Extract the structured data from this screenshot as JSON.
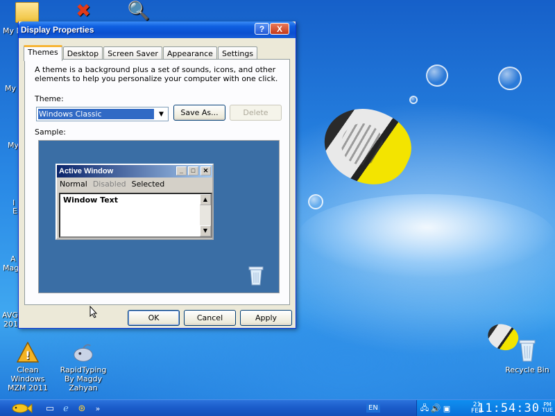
{
  "desktop": {
    "icons": [
      {
        "label": "Clean Windows MZM 2011"
      },
      {
        "label": "RapidTyping By Magdy Zahyan"
      },
      {
        "label": "Recycle Bin"
      }
    ],
    "edge_labels": [
      "My D",
      "My",
      "My",
      "I",
      "E",
      "A",
      "Mag",
      "AVG",
      "201"
    ]
  },
  "dialog": {
    "title": "Display Properties",
    "help_label": "?",
    "close_label": "X",
    "tabs": [
      "Themes",
      "Desktop",
      "Screen Saver",
      "Appearance",
      "Settings"
    ],
    "description": "A theme is a background plus a set of sounds, icons, and other elements to help you personalize your computer with one click.",
    "theme_label": "Theme:",
    "theme_value": "Windows Classic",
    "save_as_label": "Save As...",
    "delete_label": "Delete",
    "sample_label": "Sample:",
    "sample": {
      "window_title": "Active Window",
      "menu": [
        "Normal",
        "Disabled",
        "Selected"
      ],
      "window_text": "Window Text"
    },
    "ok_label": "OK",
    "cancel_label": "Cancel",
    "apply_label": "Apply"
  },
  "taskbar": {
    "language": "EN",
    "date_day": "21",
    "date_month": "FEB",
    "time": "11:54:30",
    "ampm_top": "PM",
    "ampm_bottom": "TUE"
  }
}
